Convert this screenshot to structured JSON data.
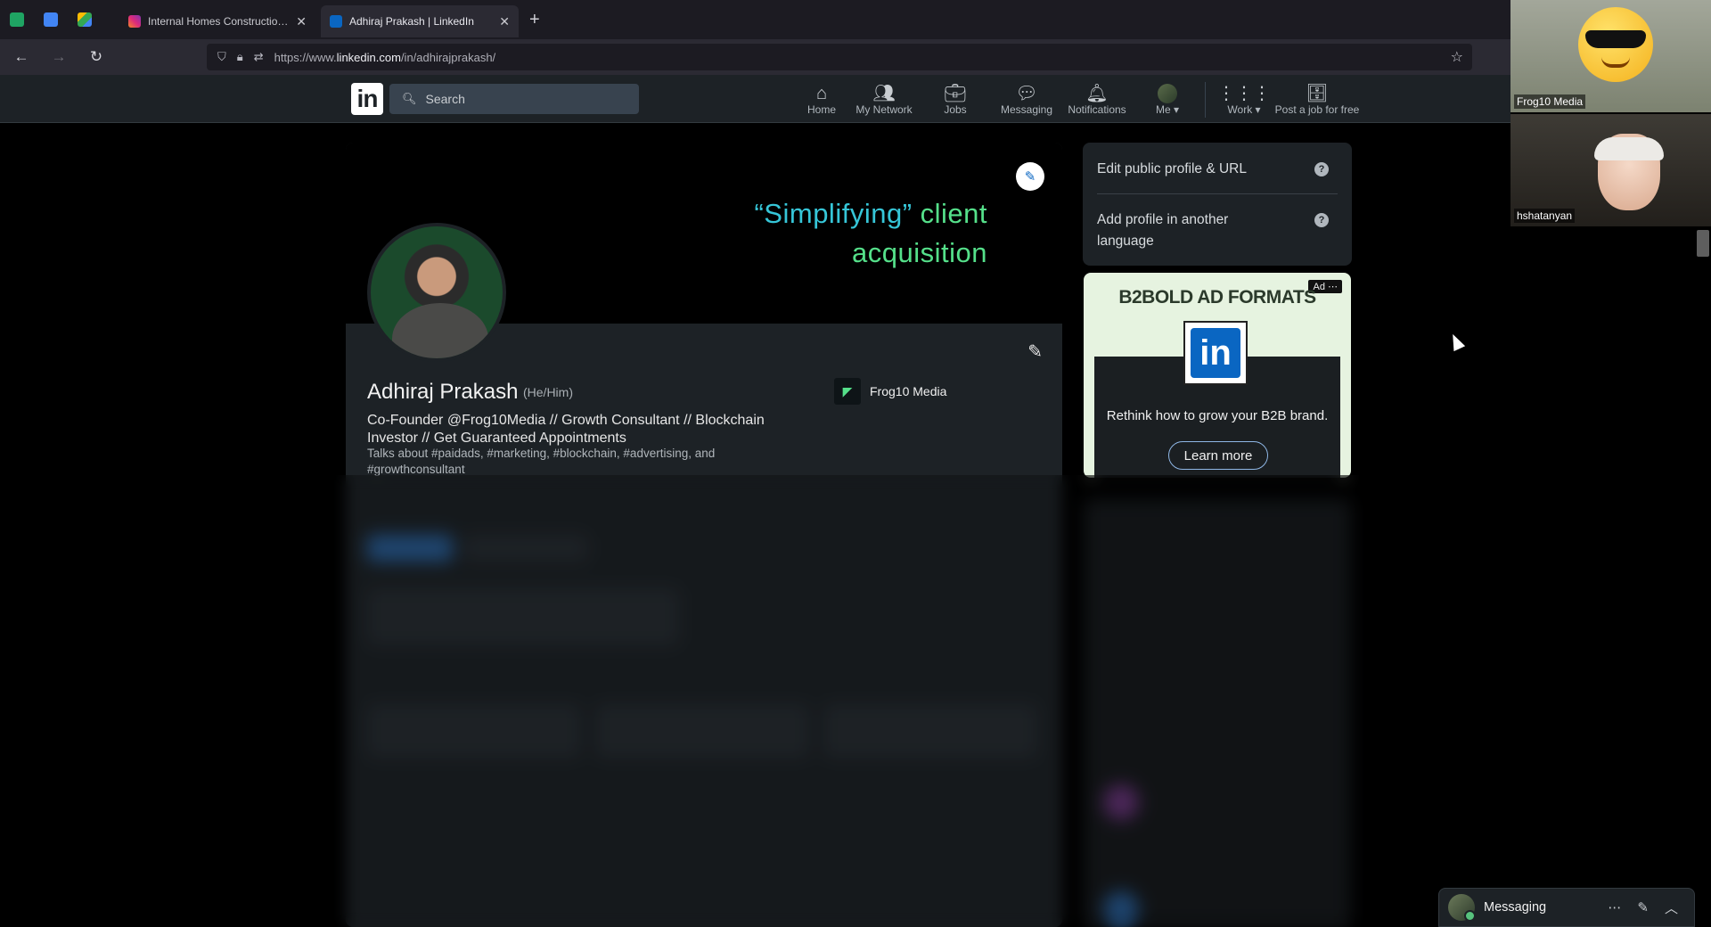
{
  "browser": {
    "tabs": [
      {
        "label": "Internal Homes Construction In"
      },
      {
        "label": "Adhiraj Prakash | LinkedIn"
      }
    ],
    "new_tab": "+",
    "close": "✕",
    "url_prefix": "https://www.",
    "url_domain": "linkedin.com",
    "url_path": "/in/adhirajprakash/"
  },
  "linkedin": {
    "logo": "in",
    "search_placeholder": "Search",
    "nav": {
      "home": "Home",
      "network": "My Network",
      "jobs": "Jobs",
      "messaging": "Messaging",
      "notifications": "Notifications",
      "me": "Me ▾",
      "work": "Work ▾",
      "post_job": "Post a job for free"
    }
  },
  "profile": {
    "banner_line1_a": "“Simplifying”",
    "banner_line1_b": " client",
    "banner_line2": "acquisition",
    "name": "Adhiraj Prakash",
    "pronouns": "(He/Him)",
    "headline": "Co-Founder @Frog10Media // Growth Consultant // Blockchain Investor // Get Guaranteed Appointments",
    "talks_about": "Talks about #paidads, #marketing, #blockchain, #advertising, and #growthconsultant",
    "company": "Frog10 Media"
  },
  "sidebar": {
    "edit_profile": "Edit public profile & URL",
    "add_language": "Add profile in another language",
    "help": "?"
  },
  "ad": {
    "tag": "Ad ⋯",
    "title": "B2BOLD AD FORMATS",
    "copy": "Rethink how to grow your B2B brand.",
    "cta": "Learn more"
  },
  "call": {
    "participant1": "Frog10 Media",
    "participant2": "hshatanyan"
  },
  "messaging": {
    "label": "Messaging",
    "more": "⋯",
    "compose": "✎",
    "collapse": "︿"
  }
}
